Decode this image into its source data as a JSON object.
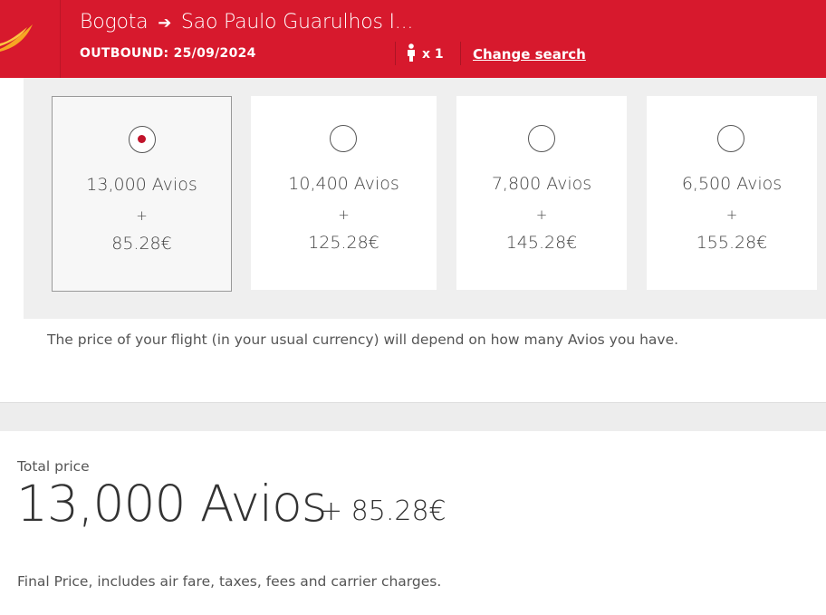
{
  "header": {
    "origin": "Bogota",
    "arrow": "➔",
    "destination": "Sao Paulo Guarulhos I...",
    "outbound": "OUTBOUND: 25/09/2024",
    "passengers": "x 1",
    "change_search": "Change search",
    "brand_color": "#d7192d"
  },
  "options": [
    {
      "avios": "13,000 Avios",
      "plus": "+",
      "cash": "85.28€",
      "selected": true
    },
    {
      "avios": "10,400 Avios",
      "plus": "+",
      "cash": "125.28€",
      "selected": false
    },
    {
      "avios": "7,800 Avios",
      "plus": "+",
      "cash": "145.28€",
      "selected": false
    },
    {
      "avios": "6,500 Avios",
      "plus": "+",
      "cash": "155.28€",
      "selected": false
    }
  ],
  "note": "The price of your flight (in your usual currency) will depend on how many Avios you have.",
  "total": {
    "label": "Total price",
    "avios": "13,000 Avios",
    "cash": "+ 85.28€",
    "final_note": "Final Price, includes air fare, taxes, fees and carrier charges."
  }
}
